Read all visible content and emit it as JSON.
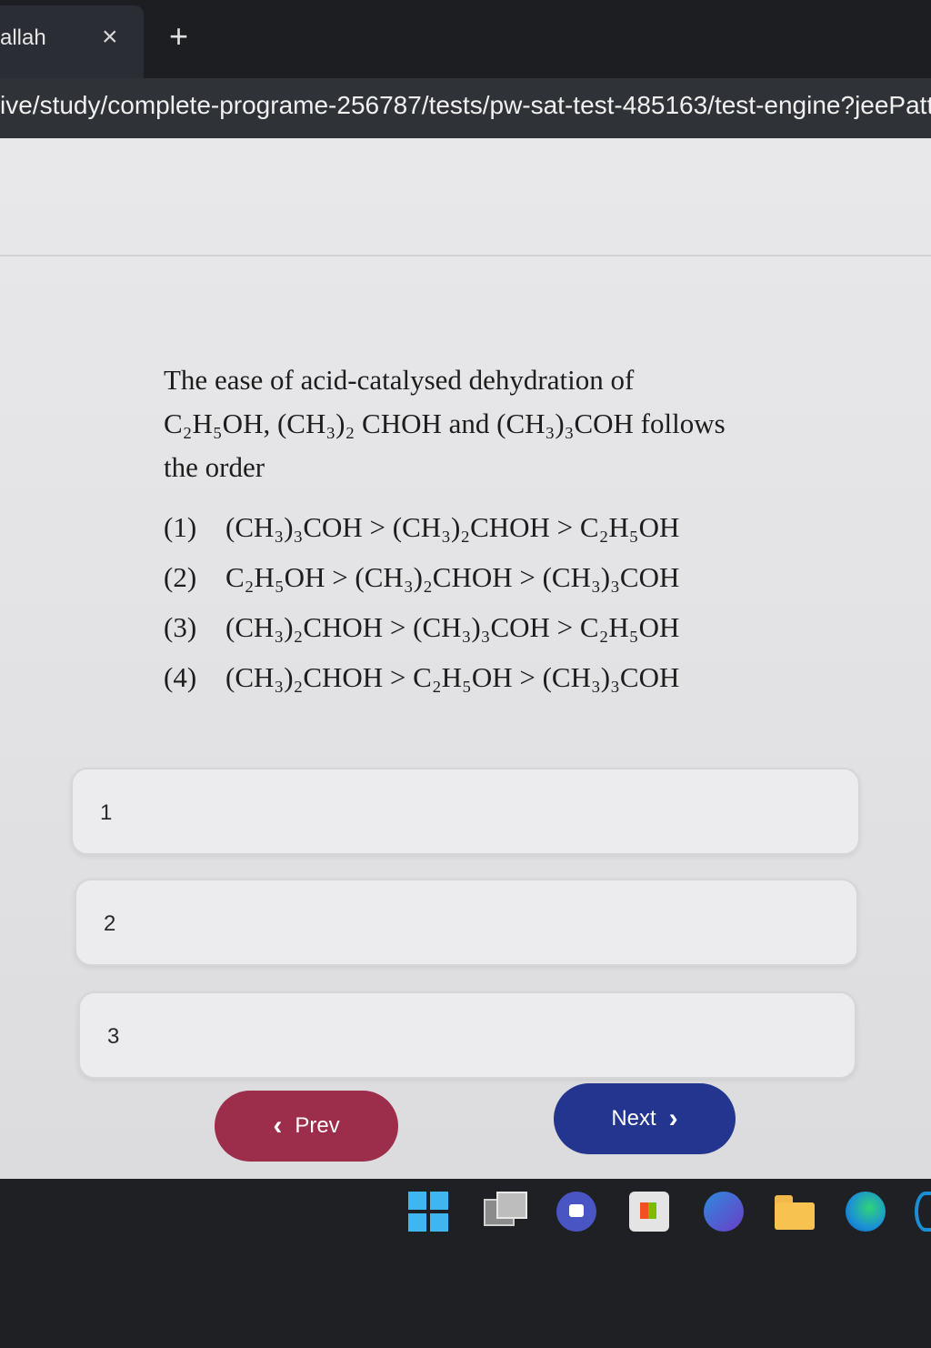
{
  "browser": {
    "tab_title": "allah",
    "tab_close": "×",
    "new_tab": "+",
    "url": "ive/study/complete-programe-256787/tests/pw-sat-test-485163/test-engine?jeePatt"
  },
  "question": {
    "line1": "The ease of acid-catalysed dehydration of",
    "compound1": "C₂H₅OH, (CH₃)₂ CHOH and (CH₃)₃COH follows",
    "line3": "the order"
  },
  "options": [
    {
      "num": "(1)",
      "text": "(CH₃)₃COH > (CH₃)₂CHOH > C₂H₅OH"
    },
    {
      "num": "(2)",
      "text": "C₂H₅OH > (CH₃)₂CHOH > (CH₃)₃COH"
    },
    {
      "num": "(3)",
      "text": "(CH₃)₂CHOH > (CH₃)₃COH > C₂H₅OH"
    },
    {
      "num": "(4)",
      "text": "(CH₃)₂CHOH > C₂H₅OH > (CH₃)₃COH"
    }
  ],
  "answers": [
    "1",
    "2",
    "3"
  ],
  "nav": {
    "prev_label": "Prev",
    "next_label": "Next"
  },
  "colors": {
    "prev": "#9c2e4c",
    "next": "#23358f"
  },
  "taskbar_icons": [
    "windows-start-icon",
    "task-view-icon",
    "teams-meet-icon",
    "store-icon",
    "copilot-icon",
    "file-explorer-icon",
    "edge-icon"
  ]
}
